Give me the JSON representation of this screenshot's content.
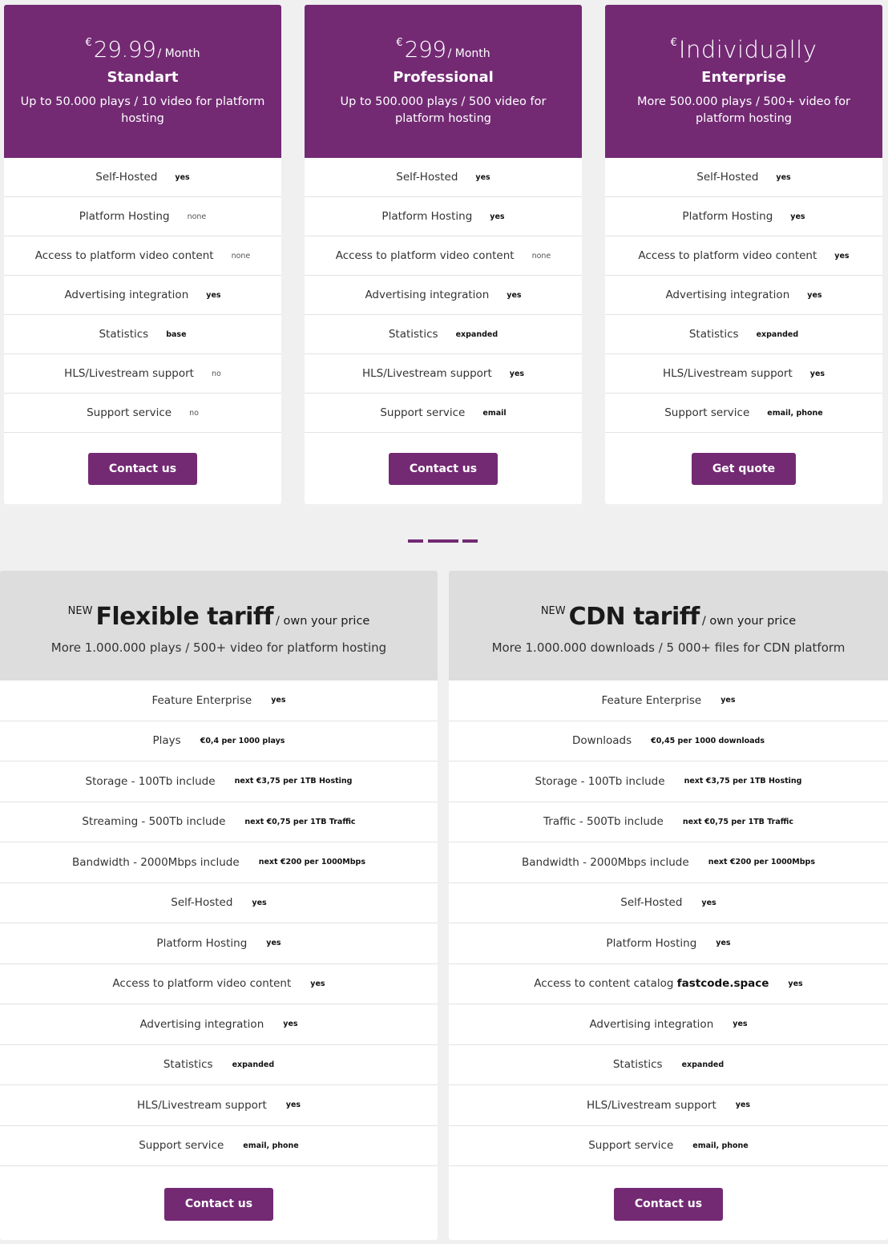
{
  "colors": {
    "accent": "#732a73",
    "background": "#f0f0f0",
    "tariff_header": "#dddddd"
  },
  "plans": [
    {
      "currency": "€",
      "price": "29.99",
      "period": "/ Month",
      "name": "Standart",
      "description": "Up to 50.000 plays / 10 video for platform hosting",
      "features": [
        {
          "label": "Self-Hosted",
          "value": "yes",
          "bold": true
        },
        {
          "label": "Platform Hosting",
          "value": "none",
          "bold": false
        },
        {
          "label": "Access to platform video content",
          "value": "none",
          "bold": false
        },
        {
          "label": "Advertising integration",
          "value": "yes",
          "bold": true
        },
        {
          "label": "Statistics",
          "value": "base",
          "bold": true
        },
        {
          "label": "HLS/Livestream support",
          "value": "no",
          "bold": false
        },
        {
          "label": "Support service",
          "value": "no",
          "bold": false
        }
      ],
      "button": "Contact us"
    },
    {
      "currency": "€",
      "price": "299",
      "period": "/ Month",
      "name": "Professional",
      "description": "Up to 500.000 plays / 500 video for platform hosting",
      "features": [
        {
          "label": "Self-Hosted",
          "value": "yes",
          "bold": true
        },
        {
          "label": "Platform Hosting",
          "value": "yes",
          "bold": true
        },
        {
          "label": "Access to platform video content",
          "value": "none",
          "bold": false
        },
        {
          "label": "Advertising integration",
          "value": "yes",
          "bold": true
        },
        {
          "label": "Statistics",
          "value": "expanded",
          "bold": true
        },
        {
          "label": "HLS/Livestream support",
          "value": "yes",
          "bold": true
        },
        {
          "label": "Support service",
          "value": "email",
          "bold": true
        }
      ],
      "button": "Contact us"
    },
    {
      "currency": "€",
      "price": "Individually",
      "period": "",
      "name": "Enterprise",
      "description": "More 500.000 plays / 500+ video for platform hosting",
      "features": [
        {
          "label": "Self-Hosted",
          "value": "yes",
          "bold": true
        },
        {
          "label": "Platform Hosting",
          "value": "yes",
          "bold": true
        },
        {
          "label": "Access to platform video content",
          "value": "yes",
          "bold": true
        },
        {
          "label": "Advertising integration",
          "value": "yes",
          "bold": true
        },
        {
          "label": "Statistics",
          "value": "expanded",
          "bold": true
        },
        {
          "label": "HLS/Livestream support",
          "value": "yes",
          "bold": true
        },
        {
          "label": "Support service",
          "value": "email, phone",
          "bold": true
        }
      ],
      "button": "Get quote"
    }
  ],
  "pager": {
    "count": 3,
    "active_index": 1
  },
  "tariffs": [
    {
      "badge": "NEW",
      "name": "Flexible tariff",
      "subtitle": "/ own your price",
      "description": "More 1.000.000 plays / 500+ video for platform hosting",
      "features": [
        {
          "label": "Feature Enterprise",
          "value": "yes"
        },
        {
          "label": "Plays",
          "value": "€0,4 per 1000 plays"
        },
        {
          "label": "Storage - 100Tb include",
          "value": "next €3,75 per 1TB Hosting"
        },
        {
          "label": "Streaming - 500Tb include",
          "value": "next €0,75 per 1TB Traffic"
        },
        {
          "label": "Bandwidth - 2000Mbps include",
          "value": "next €200 per 1000Mbps"
        },
        {
          "label": "Self-Hosted",
          "value": "yes"
        },
        {
          "label": "Platform Hosting",
          "value": "yes"
        },
        {
          "label": "Access to platform video content",
          "value": "yes"
        },
        {
          "label": "Advertising integration",
          "value": "yes"
        },
        {
          "label": "Statistics",
          "value": "expanded"
        },
        {
          "label": "HLS/Livestream support",
          "value": "yes"
        },
        {
          "label": "Support service",
          "value": "email, phone"
        }
      ],
      "button": "Contact us"
    },
    {
      "badge": "NEW",
      "name": "CDN tariff",
      "subtitle": "/ own your price",
      "description": "More 1.000.000 downloads / 5 000+ files for CDN platform",
      "features": [
        {
          "label": "Feature Enterprise",
          "value": "yes"
        },
        {
          "label": "Downloads",
          "value": "€0,45 per 1000 downloads"
        },
        {
          "label": "Storage - 100Tb include",
          "value": "next €3,75 per 1TB Hosting"
        },
        {
          "label": "Traffic - 500Tb include",
          "value": "next €0,75 per 1TB Traffic"
        },
        {
          "label": "Bandwidth - 2000Mbps include",
          "value": "next €200 per 1000Mbps"
        },
        {
          "label": "Self-Hosted",
          "value": "yes"
        },
        {
          "label": "Platform Hosting",
          "value": "yes"
        },
        {
          "label": "Access to content catalog",
          "label_strong": "fastcode.space",
          "value": "yes"
        },
        {
          "label": "Advertising integration",
          "value": "yes"
        },
        {
          "label": "Statistics",
          "value": "expanded"
        },
        {
          "label": "HLS/Livestream support",
          "value": "yes"
        },
        {
          "label": "Support service",
          "value": "email, phone"
        }
      ],
      "button": "Contact us"
    }
  ]
}
